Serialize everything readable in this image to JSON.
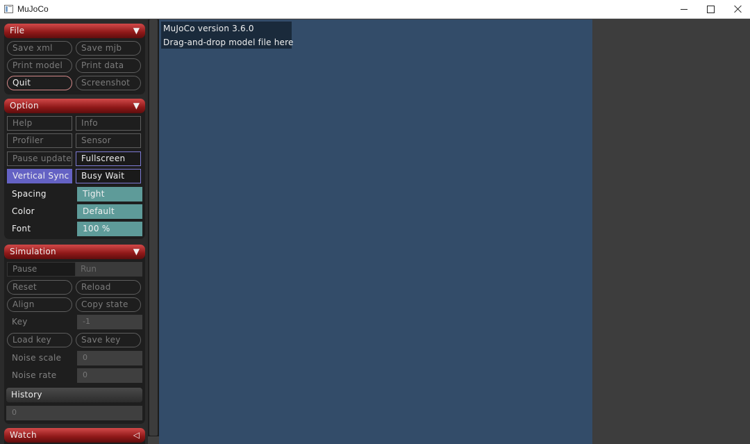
{
  "window": {
    "title": "MuJoCo"
  },
  "file": {
    "title": "File",
    "arrow": "▼",
    "buttons": [
      "Save xml",
      "Save mjb",
      "Print model",
      "Print data",
      "Quit",
      "Screenshot"
    ]
  },
  "option": {
    "title": "Option",
    "arrow": "▼",
    "buttons": [
      "Help",
      "Info",
      "Profiler",
      "Sensor",
      "Pause update",
      "Fullscreen",
      "Vertical Sync",
      "Busy Wait"
    ],
    "spacing": {
      "label": "Spacing",
      "value": "Tight"
    },
    "color": {
      "label": "Color",
      "value": "Default"
    },
    "font": {
      "label": "Font",
      "value": "100 %"
    }
  },
  "simulation": {
    "title": "Simulation",
    "arrow": "▼",
    "pause": "Pause",
    "run": "Run",
    "reset": "Reset",
    "reload": "Reload",
    "align": "Align",
    "copy_state": "Copy state",
    "key": {
      "label": "Key",
      "value": "-1"
    },
    "load_key": "Load key",
    "save_key": "Save key",
    "noise_scale": {
      "label": "Noise scale",
      "value": "0"
    },
    "noise_rate": {
      "label": "Noise rate",
      "value": "0"
    },
    "history": {
      "label": "History",
      "value": "0"
    }
  },
  "watch": {
    "title": "Watch",
    "arrow": "◁"
  },
  "viewport": {
    "version": "MuJoCo version 3.6.0",
    "hint": "Drag-and-drop model file here"
  },
  "colors": {
    "section_header": "#8e1818",
    "accent_blue": "#6462c4",
    "teal": "#5e9b99",
    "viewport_bg": "#334c69"
  }
}
